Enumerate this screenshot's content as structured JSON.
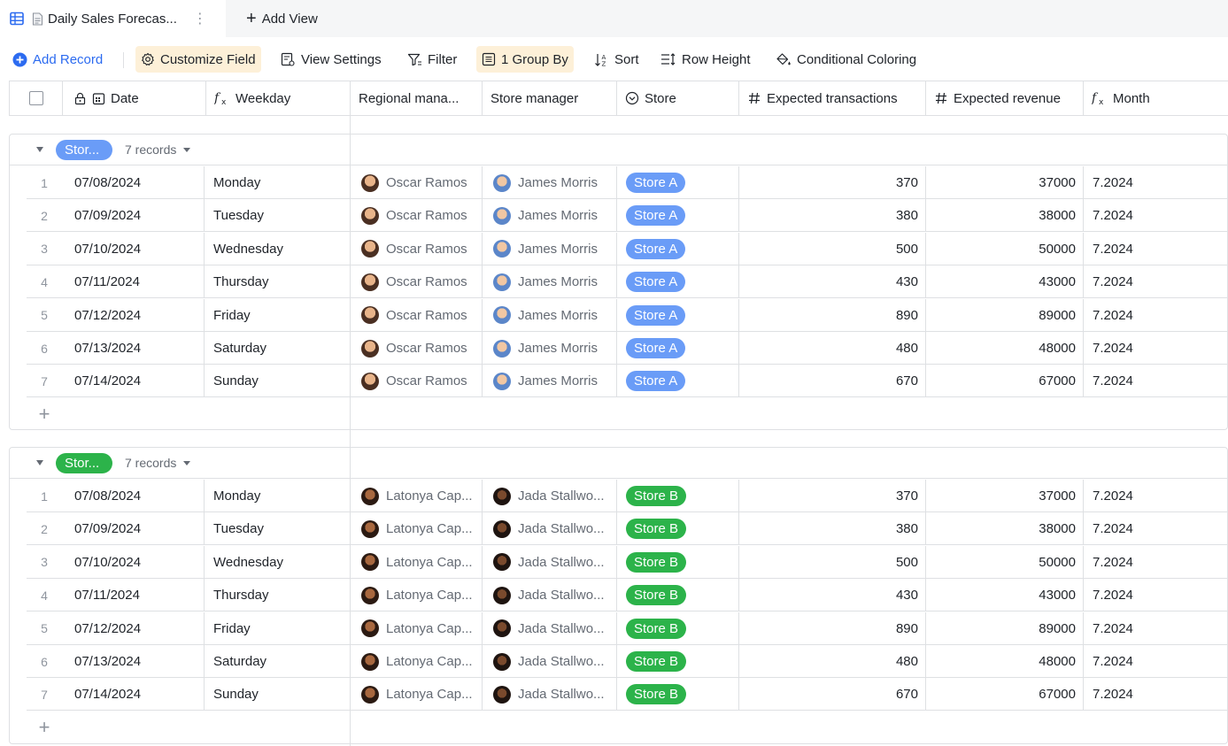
{
  "tab": {
    "title": "Daily Sales Forecas...",
    "menu_glyph": "⋮"
  },
  "add_view": {
    "label": "Add View"
  },
  "toolbar": {
    "add_record": "Add Record",
    "customize_field": "Customize Field",
    "view_settings": "View Settings",
    "filter": "Filter",
    "group_by": "1 Group By",
    "sort": "Sort",
    "row_height": "Row Height",
    "conditional_coloring": "Conditional Coloring"
  },
  "columns": {
    "date": "Date",
    "weekday": "Weekday",
    "regional_manager": "Regional mana...",
    "store_manager": "Store manager",
    "store": "Store",
    "expected_transactions": "Expected transactions",
    "expected_revenue": "Expected revenue",
    "month": "Month"
  },
  "colors": {
    "accent": "#2c6bf0",
    "store_a": "#6a9cf7",
    "store_b": "#2cb34a",
    "highlight": "#fdf0d8"
  },
  "groups": [
    {
      "tag": "Stor...",
      "count": "7 records",
      "color": "#6a9cf7",
      "rows": [
        {
          "idx": "1",
          "date": "07/08/2024",
          "weekday": "Monday",
          "regional": "Oscar Ramos",
          "manager": "James Morris",
          "store": "Store A",
          "transactions": "370",
          "revenue": "37000",
          "month": "7.2024"
        },
        {
          "idx": "2",
          "date": "07/09/2024",
          "weekday": "Tuesday",
          "regional": "Oscar Ramos",
          "manager": "James Morris",
          "store": "Store A",
          "transactions": "380",
          "revenue": "38000",
          "month": "7.2024"
        },
        {
          "idx": "3",
          "date": "07/10/2024",
          "weekday": "Wednesday",
          "regional": "Oscar Ramos",
          "manager": "James Morris",
          "store": "Store A",
          "transactions": "500",
          "revenue": "50000",
          "month": "7.2024"
        },
        {
          "idx": "4",
          "date": "07/11/2024",
          "weekday": "Thursday",
          "regional": "Oscar Ramos",
          "manager": "James Morris",
          "store": "Store A",
          "transactions": "430",
          "revenue": "43000",
          "month": "7.2024"
        },
        {
          "idx": "5",
          "date": "07/12/2024",
          "weekday": "Friday",
          "regional": "Oscar Ramos",
          "manager": "James Morris",
          "store": "Store A",
          "transactions": "890",
          "revenue": "89000",
          "month": "7.2024"
        },
        {
          "idx": "6",
          "date": "07/13/2024",
          "weekday": "Saturday",
          "regional": "Oscar Ramos",
          "manager": "James Morris",
          "store": "Store A",
          "transactions": "480",
          "revenue": "48000",
          "month": "7.2024"
        },
        {
          "idx": "7",
          "date": "07/14/2024",
          "weekday": "Sunday",
          "regional": "Oscar Ramos",
          "manager": "James Morris",
          "store": "Store A",
          "transactions": "670",
          "revenue": "67000",
          "month": "7.2024"
        }
      ]
    },
    {
      "tag": "Stor...",
      "count": "7 records",
      "color": "#2cb34a",
      "rows": [
        {
          "idx": "1",
          "date": "07/08/2024",
          "weekday": "Monday",
          "regional": "Latonya Cap...",
          "manager": "Jada Stallwo...",
          "store": "Store B",
          "transactions": "370",
          "revenue": "37000",
          "month": "7.2024"
        },
        {
          "idx": "2",
          "date": "07/09/2024",
          "weekday": "Tuesday",
          "regional": "Latonya Cap...",
          "manager": "Jada Stallwo...",
          "store": "Store B",
          "transactions": "380",
          "revenue": "38000",
          "month": "7.2024"
        },
        {
          "idx": "3",
          "date": "07/10/2024",
          "weekday": "Wednesday",
          "regional": "Latonya Cap...",
          "manager": "Jada Stallwo...",
          "store": "Store B",
          "transactions": "500",
          "revenue": "50000",
          "month": "7.2024"
        },
        {
          "idx": "4",
          "date": "07/11/2024",
          "weekday": "Thursday",
          "regional": "Latonya Cap...",
          "manager": "Jada Stallwo...",
          "store": "Store B",
          "transactions": "430",
          "revenue": "43000",
          "month": "7.2024"
        },
        {
          "idx": "5",
          "date": "07/12/2024",
          "weekday": "Friday",
          "regional": "Latonya Cap...",
          "manager": "Jada Stallwo...",
          "store": "Store B",
          "transactions": "890",
          "revenue": "89000",
          "month": "7.2024"
        },
        {
          "idx": "6",
          "date": "07/13/2024",
          "weekday": "Saturday",
          "regional": "Latonya Cap...",
          "manager": "Jada Stallwo...",
          "store": "Store B",
          "transactions": "480",
          "revenue": "48000",
          "month": "7.2024"
        },
        {
          "idx": "7",
          "date": "07/14/2024",
          "weekday": "Sunday",
          "regional": "Latonya Cap...",
          "manager": "Jada Stallwo...",
          "store": "Store B",
          "transactions": "670",
          "revenue": "67000",
          "month": "7.2024"
        }
      ]
    }
  ]
}
